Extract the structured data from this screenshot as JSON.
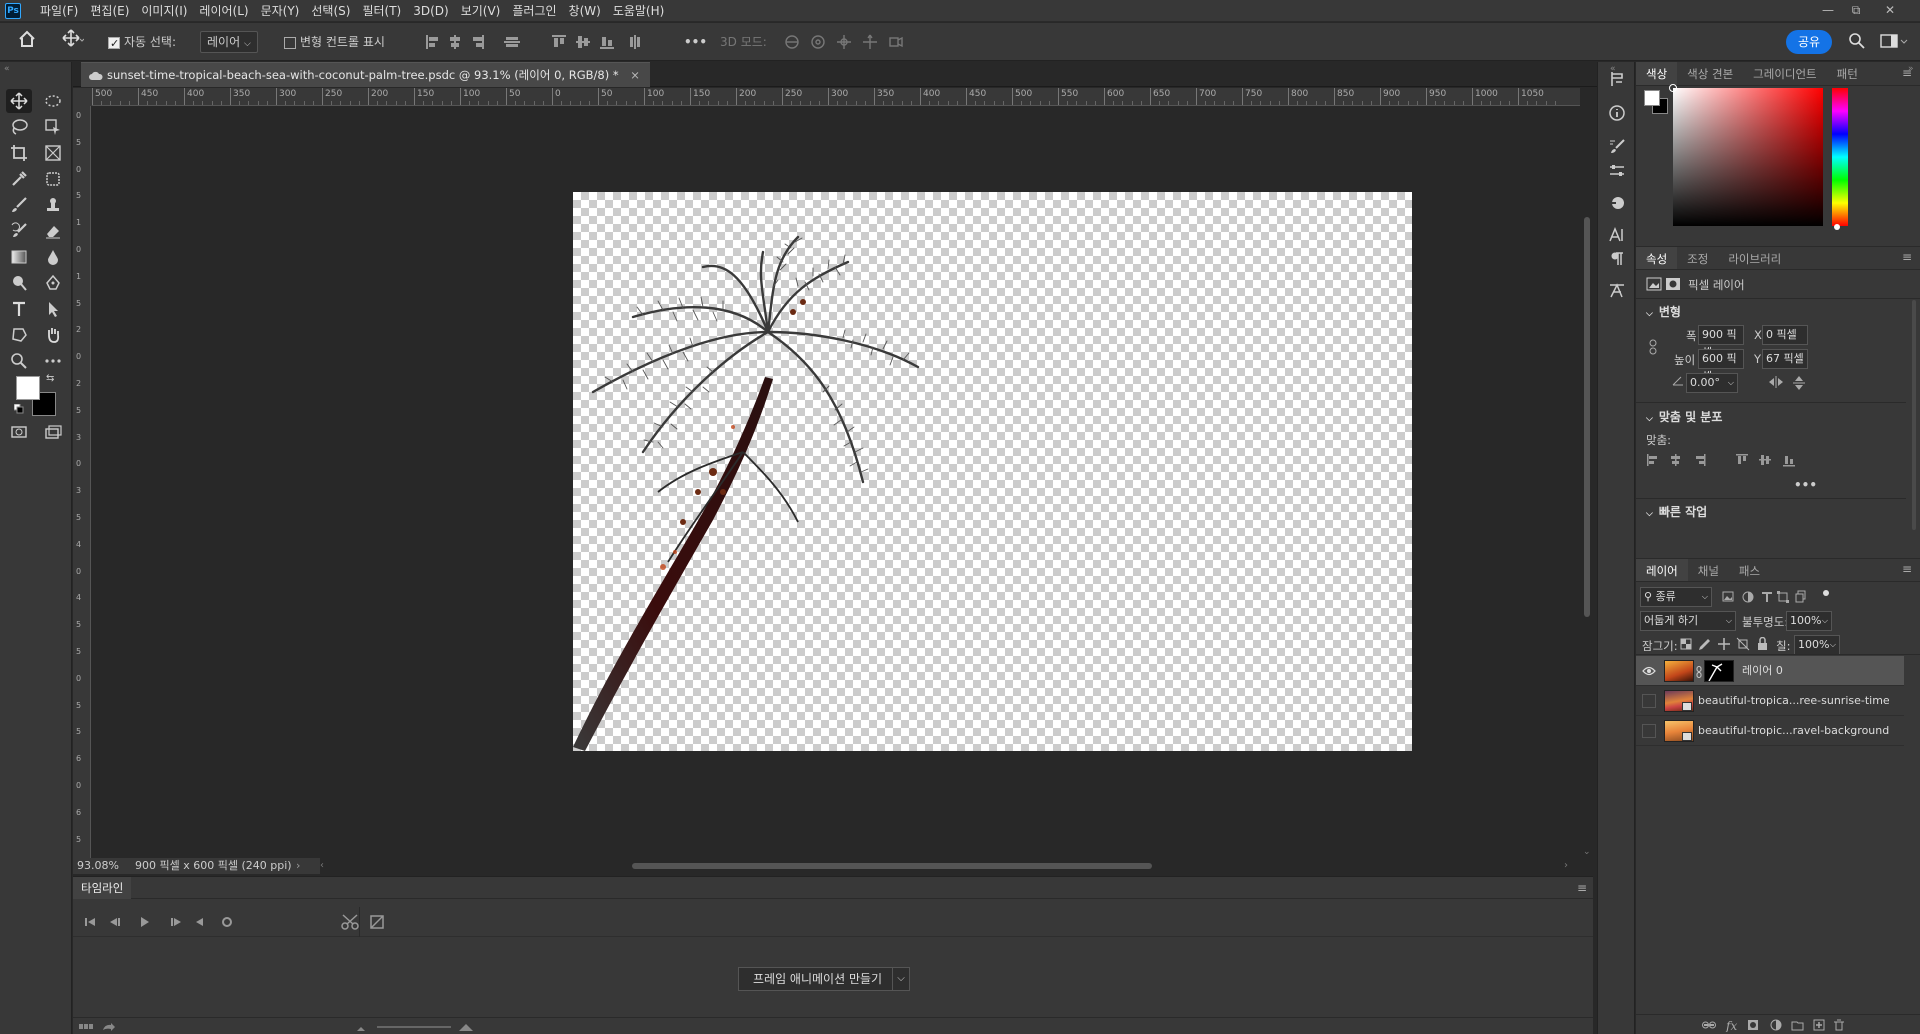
{
  "menubar": {
    "logo": "Ps",
    "items": [
      "파일(F)",
      "편집(E)",
      "이미지(I)",
      "레이어(L)",
      "문자(Y)",
      "선택(S)",
      "필터(T)",
      "3D(D)",
      "보기(V)",
      "플러그인",
      "창(W)",
      "도움말(H)"
    ],
    "window_controls": {
      "minimize": "—",
      "restore": "⧉",
      "close": "✕"
    }
  },
  "options": {
    "auto_select_label": "자동 선택:",
    "auto_select_value": "레이어",
    "show_transform_label": "변형 컨트롤 표시",
    "more": "•••",
    "mode_3d_label": "3D 모드:",
    "share_label": "공유"
  },
  "document": {
    "tab_title": "sunset-time-tropical-beach-sea-with-coconut-palm-tree.psdc @ 93.1% (레이어 0, RGB/8) *",
    "close": "×",
    "ruler_top": [
      "500",
      "450",
      "400",
      "350",
      "300",
      "250",
      "200",
      "150",
      "100",
      "50",
      "0",
      "50",
      "100",
      "150",
      "200",
      "250",
      "300",
      "350",
      "400",
      "450",
      "500",
      "550",
      "600",
      "650",
      "700",
      "750",
      "800",
      "850",
      "900",
      "950",
      "1000",
      "1050"
    ],
    "ruler_left": [
      "0",
      "5",
      "0",
      "5",
      "1",
      "0",
      "1",
      "5",
      "2",
      "0",
      "2",
      "5",
      "3",
      "0",
      "3",
      "5",
      "4",
      "0",
      "4",
      "5",
      "5",
      "0",
      "5",
      "5",
      "6",
      "0",
      "6",
      "5"
    ],
    "zoom": "93.08%",
    "doc_info": "900 픽셀 x 600 픽셀 (240 ppi)"
  },
  "timeline": {
    "title": "타임라인",
    "create_frame_label": "프레임 애니메이션 만들기"
  },
  "color_panel": {
    "tabs": [
      "색상",
      "색상 견본",
      "그레이디언트",
      "패턴"
    ],
    "hue": "#ff0000"
  },
  "properties": {
    "tabs": [
      "속성",
      "조정",
      "라이브러리"
    ],
    "kind_label": "픽셀 레이어",
    "transform_title": "변형",
    "width_label": "폭",
    "width": "900 픽셀",
    "height_label": "높이",
    "height": "600 픽셀",
    "x_label": "X",
    "x": "0 픽셀",
    "y_label": "Y",
    "y": "67 픽셀",
    "angle": "0.00°",
    "align_title": "맞춤 및 분포",
    "align_label": "맞춤:",
    "more": "•••",
    "quick_title": "빠른 작업"
  },
  "layers_panel": {
    "tabs": [
      "레이어",
      "채널",
      "패스"
    ],
    "filter_label": "종류",
    "blend_mode": "어둡게 하기",
    "opacity_label": "불투명도:",
    "opacity": "100%",
    "lock_label": "잠그기:",
    "fill_label": "칠:",
    "fill": "100%",
    "layers": [
      {
        "name": "레이어 0",
        "visible": true,
        "selected": true
      },
      {
        "name": "beautiful-tropica...ree-sunrise-time",
        "visible": false,
        "selected": false
      },
      {
        "name": "beautiful-tropic...ravel-background",
        "visible": false,
        "selected": false
      }
    ]
  },
  "colors": {
    "foreground": "#ffffff",
    "background": "#000000",
    "accent": "#1473e6"
  }
}
